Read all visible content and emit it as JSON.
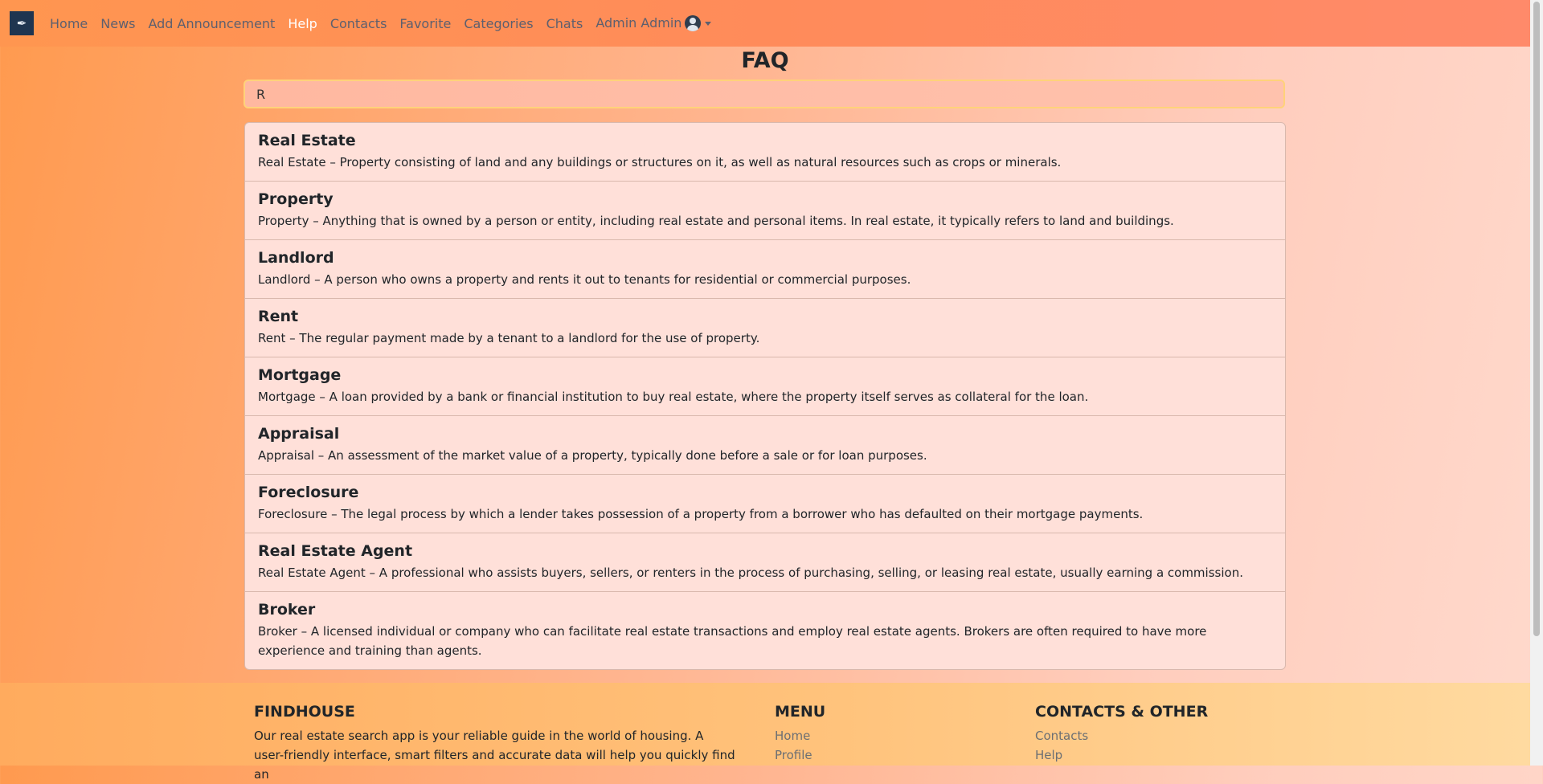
{
  "navbar": {
    "brand_icon": "feather-logo-icon",
    "links": [
      {
        "label": "Home",
        "active": false
      },
      {
        "label": "News",
        "active": false
      },
      {
        "label": "Add Announcement",
        "active": false
      },
      {
        "label": "Help",
        "active": true
      },
      {
        "label": "Contacts",
        "active": false
      },
      {
        "label": "Favorite",
        "active": false
      },
      {
        "label": "Categories",
        "active": false
      },
      {
        "label": "Chats",
        "active": false
      }
    ],
    "user_label": "Admin Admin"
  },
  "page": {
    "title": "FAQ",
    "search_value": "R"
  },
  "faq": [
    {
      "title": "Real Estate",
      "text": "Real Estate – Property consisting of land and any buildings or structures on it, as well as natural resources such as crops or minerals."
    },
    {
      "title": "Property",
      "text": "Property – Anything that is owned by a person or entity, including real estate and personal items. In real estate, it typically refers to land and buildings."
    },
    {
      "title": "Landlord",
      "text": "Landlord – A person who owns a property and rents it out to tenants for residential or commercial purposes."
    },
    {
      "title": "Rent",
      "text": "Rent – The regular payment made by a tenant to a landlord for the use of property."
    },
    {
      "title": "Mortgage",
      "text": "Mortgage – A loan provided by a bank or financial institution to buy real estate, where the property itself serves as collateral for the loan."
    },
    {
      "title": "Appraisal",
      "text": "Appraisal – An assessment of the market value of a property, typically done before a sale or for loan purposes."
    },
    {
      "title": "Foreclosure",
      "text": "Foreclosure – The legal process by which a lender takes possession of a property from a borrower who has defaulted on their mortgage payments."
    },
    {
      "title": "Real Estate Agent",
      "text": "Real Estate Agent – A professional who assists buyers, sellers, or renters in the process of purchasing, selling, or leasing real estate, usually earning a commission."
    },
    {
      "title": "Broker",
      "text": "Broker – A licensed individual or company who can facilitate real estate transactions and employ real estate agents. Brokers are often required to have more experience and training than agents."
    }
  ],
  "footer": {
    "about_title": "FINDHOUSE",
    "about_text": "Our real estate search app is your reliable guide in the world of housing. A user-friendly interface, smart filters and accurate data will help you quickly find an",
    "menu_title": "MENU",
    "menu_links": [
      "Home",
      "Profile"
    ],
    "contacts_title": "CONTACTS & OTHER",
    "contacts_links": [
      "Contacts",
      "Help"
    ]
  }
}
